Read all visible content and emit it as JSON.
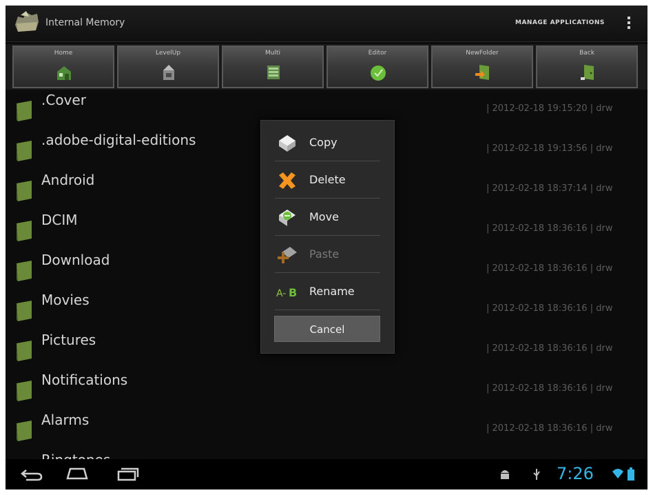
{
  "action_bar": {
    "title": "Internal Memory",
    "manage_applications": "MANAGE APPLICATIONS"
  },
  "toolbar": [
    {
      "label": "Home",
      "icon": "home-icon"
    },
    {
      "label": "LevelUp",
      "icon": "level-up-icon"
    },
    {
      "label": "Multi",
      "icon": "multi-select-icon"
    },
    {
      "label": "Editor",
      "icon": "editor-icon"
    },
    {
      "label": "NewFolder",
      "icon": "new-folder-icon"
    },
    {
      "label": "Back",
      "icon": "back-door-icon"
    }
  ],
  "files": [
    {
      "name": ".Cover",
      "meta": "| 2012-02-18 19:15:20 | drw"
    },
    {
      "name": ".adobe-digital-editions",
      "meta": "| 2012-02-18 19:13:56 | drw"
    },
    {
      "name": "Android",
      "meta": "| 2012-02-18 18:37:14 | drw"
    },
    {
      "name": "DCIM",
      "meta": "| 2012-02-18 18:36:16 | drw"
    },
    {
      "name": "Download",
      "meta": "| 2012-02-18 18:36:16 | drw"
    },
    {
      "name": "Movies",
      "meta": "| 2012-02-18 18:36:16 | drw"
    },
    {
      "name": "Pictures",
      "meta": "| 2012-02-18 18:36:16 | drw"
    },
    {
      "name": "Notifications",
      "meta": "| 2012-02-18 18:36:16 | drw"
    },
    {
      "name": "Alarms",
      "meta": "| 2012-02-18 18:36:16 | drw"
    },
    {
      "name": "Ringtones",
      "meta": ""
    }
  ],
  "dialog": {
    "items": [
      {
        "label": "Copy",
        "icon": "copy-icon",
        "enabled": true
      },
      {
        "label": "Delete",
        "icon": "delete-icon",
        "enabled": true
      },
      {
        "label": "Move",
        "icon": "move-icon",
        "enabled": true
      },
      {
        "label": "Paste",
        "icon": "paste-icon",
        "enabled": false
      },
      {
        "label": "Rename",
        "icon": "rename-icon",
        "enabled": true
      }
    ],
    "cancel": "Cancel"
  },
  "status_bar": {
    "clock": "7:26"
  },
  "colors": {
    "accent": "#33b5e5",
    "folder": "#6a8a3a"
  }
}
